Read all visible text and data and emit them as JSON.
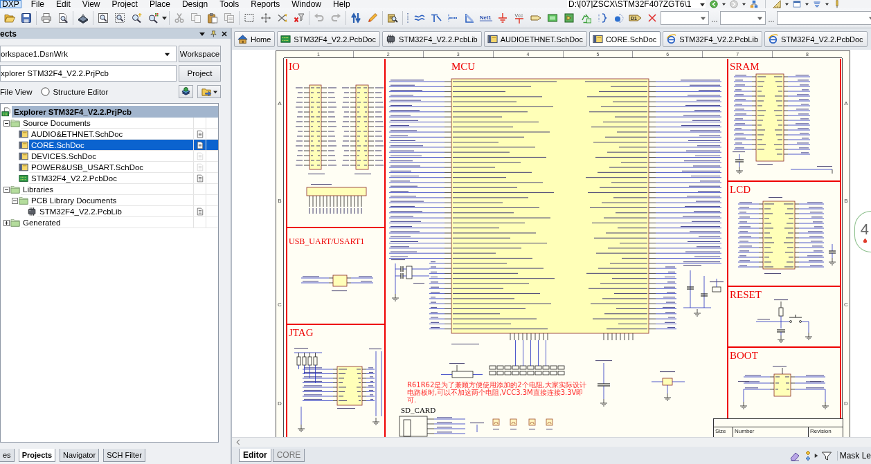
{
  "menu": [
    {
      "label": "DXP",
      "highlighted": true
    },
    {
      "label": "File",
      "highlighted": false
    },
    {
      "label": "Edit",
      "highlighted": false
    },
    {
      "label": "View",
      "highlighted": false
    },
    {
      "label": "Project",
      "highlighted": false
    },
    {
      "label": "Place",
      "highlighted": false
    },
    {
      "label": "Design",
      "highlighted": false
    },
    {
      "label": "Tools",
      "highlighted": false
    },
    {
      "label": "Reports",
      "highlighted": false
    },
    {
      "label": "Window",
      "highlighted": false
    },
    {
      "label": "Help",
      "highlighted": false
    }
  ],
  "path_box": {
    "value": "D:\\[07]ZSCX\\STM32F407ZGT6\\1"
  },
  "toolbar": {
    "net_label_icon": "Net1",
    "power_port_icon": "Vcc",
    "part_icon": "D1"
  },
  "panel": {
    "title": "ects",
    "workspace": {
      "value": "orkspace1.DsnWrk"
    },
    "workspace_button": "Workspace",
    "project_field": {
      "value": "xplorer STM32F4_V2.2.PrjPcb"
    },
    "project_button": "Project",
    "file_view_label": "File View",
    "structure_editor": {
      "label": "Structure Editor",
      "selected": false
    },
    "tree": {
      "label": "Explorer STM32F4_V2.2.PrjPcb",
      "active": true,
      "children": [
        {
          "kind": "folder",
          "label": "Source Documents",
          "expanded": true,
          "selected": false,
          "children": [
            {
              "kind": "schdoc",
              "label": "AUDIO&ETHNET.SchDoc",
              "selected": false,
              "open": true
            },
            {
              "kind": "schdoc",
              "label": "CORE.SchDoc",
              "selected": true,
              "open": true
            },
            {
              "kind": "schdoc",
              "label": "DEVICES.SchDoc",
              "selected": false,
              "open": false
            },
            {
              "kind": "schdoc",
              "label": "POWER&USB_USART.SchDoc",
              "selected": false,
              "open": false
            },
            {
              "kind": "pcbdoc",
              "label": "STM32F4_V2.2.PcbDoc",
              "selected": false,
              "open": true
            }
          ]
        },
        {
          "kind": "folder",
          "label": "Libraries",
          "expanded": true,
          "selected": false,
          "children": [
            {
              "kind": "folder",
              "label": "PCB Library Documents",
              "expanded": true,
              "selected": false,
              "children": [
                {
                  "kind": "pcblib",
                  "label": "STM32F4_V2.2.PcbLib",
                  "selected": false,
                  "open": true
                }
              ]
            }
          ]
        },
        {
          "kind": "folder",
          "label": "Generated",
          "expanded": false,
          "selected": false
        }
      ]
    },
    "tabs": [
      {
        "label": "es",
        "selected": false
      },
      {
        "label": "Projects",
        "selected": true
      },
      {
        "label": "Navigator",
        "selected": false
      },
      {
        "label": "SCH Filter",
        "selected": false
      }
    ]
  },
  "document_tabs": [
    {
      "kind": "home",
      "label": "Home",
      "selected": false
    },
    {
      "kind": "pcbdoc",
      "label": "STM32F4_V2.2.PcbDoc",
      "selected": false
    },
    {
      "kind": "pcblib",
      "label": "STM32F4_V2.2.PcbLib",
      "selected": false
    },
    {
      "kind": "schdoc",
      "label": "AUDIOETHNET.SchDoc",
      "selected": false
    },
    {
      "kind": "schdoc",
      "label": "CORE.SchDoc",
      "selected": true
    },
    {
      "kind": "web",
      "label": "STM32F4_V2.2.PcbLib",
      "selected": false
    },
    {
      "kind": "web",
      "label": "STM32F4_V2.2.PcbDoc",
      "selected": false
    }
  ],
  "sheet": {
    "zone_columns": [
      "1",
      "2",
      "3",
      "4",
      "5",
      "6",
      "7",
      "8"
    ],
    "zone_rows_left": [
      "A",
      "B",
      "C",
      "D"
    ],
    "zone_rows_right": [
      "A",
      "B",
      "C",
      "D"
    ],
    "sections": [
      {
        "kind": "io",
        "title": "IO"
      },
      {
        "kind": "usb",
        "title": "USB_UART/USART1"
      },
      {
        "kind": "jtag",
        "title": "JTAG"
      },
      {
        "kind": "mcu",
        "title": "MCU",
        "note": "R61R62是为了兼顾方便使用添加的2个电阻,大家实际设计电路板时,可以不加这两个电阻,VCC3.3M直接连接3.3V即可.",
        "sub_title": "SD_CARD"
      },
      {
        "kind": "sram",
        "title": "SRAM"
      },
      {
        "kind": "lcd",
        "title": "LCD"
      },
      {
        "kind": "reset",
        "title": "RESET"
      },
      {
        "kind": "boot",
        "title": "BOOT"
      }
    ],
    "title_block": [
      "Size",
      "Number",
      "Revision"
    ]
  },
  "editor_tabs": [
    {
      "label": "Editor",
      "selected": true
    },
    {
      "label": "CORE",
      "selected": false
    }
  ],
  "status_bar": {
    "mask_label": "Mask Le"
  },
  "side_widget": {
    "text": "4"
  }
}
